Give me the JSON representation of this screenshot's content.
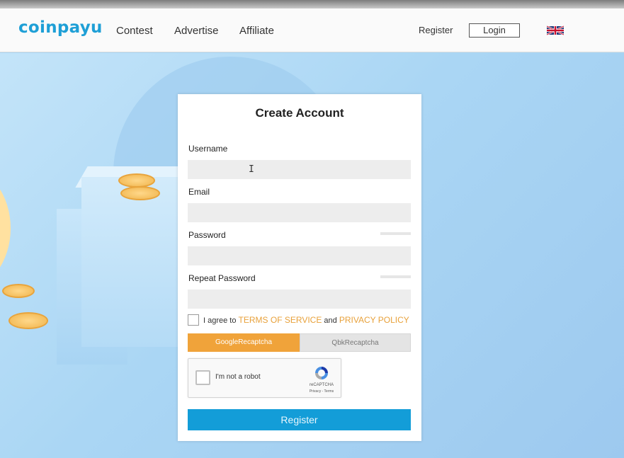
{
  "header": {
    "logo_text": "coinpayu",
    "nav": [
      {
        "label": "Contest"
      },
      {
        "label": "Advertise"
      },
      {
        "label": "Affiliate"
      }
    ],
    "register_label": "Register",
    "login_label": "Login",
    "language_icon": "uk-flag-icon"
  },
  "form": {
    "title": "Create Account",
    "fields": [
      {
        "label": "Username",
        "value": "",
        "placeholder": ""
      },
      {
        "label": "Email",
        "value": "",
        "placeholder": ""
      },
      {
        "label": "Password",
        "value": "",
        "placeholder": ""
      },
      {
        "label": "Repeat Password",
        "value": "",
        "placeholder": ""
      }
    ],
    "agree": {
      "prefix": "I agree to",
      "terms": "TERMS OF SERVICE",
      "and": "and",
      "privacy": "PRIVACY POLICY",
      "checked": false
    },
    "captcha_tabs": [
      {
        "label": "GoogleRecaptcha",
        "active": true
      },
      {
        "label": "QbkRecaptcha",
        "active": false
      }
    ],
    "recaptcha": {
      "label": "I'm not a robot",
      "brand": "reCAPTCHA",
      "links": "Privacy - Terms"
    },
    "submit_label": "Register"
  },
  "colors": {
    "brand": "#1e9fd6",
    "accent": "#f0a33a",
    "submit": "#139dd8",
    "link": "#e8a13a"
  }
}
